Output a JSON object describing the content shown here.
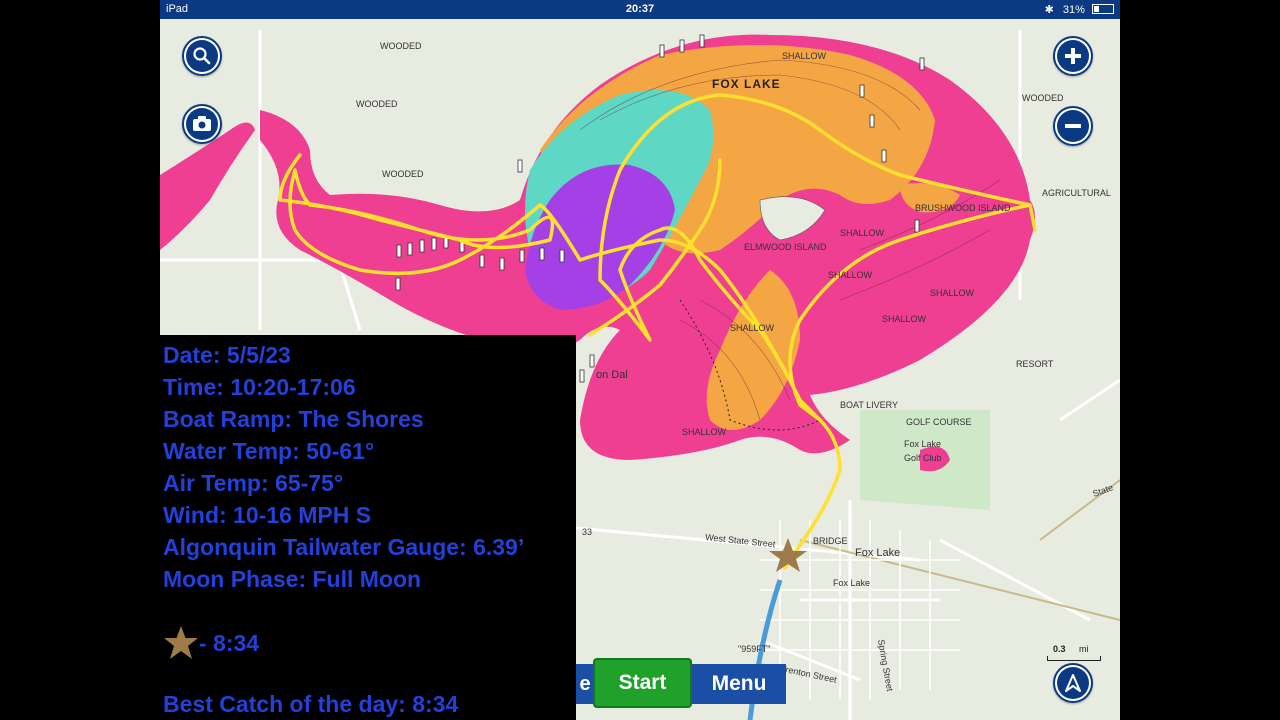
{
  "status_bar": {
    "device": "iPad",
    "time": "20:37",
    "battery": "31%"
  },
  "map": {
    "lake_name": "FOX LAKE",
    "labels": {
      "wooded_1": "WOODED",
      "wooded_2": "WOODED",
      "wooded_3": "WOODED",
      "wooded_4": "WOODED",
      "shallow_1": "SHALLOW",
      "shallow_2": "SHALLOW",
      "shallow_3": "SHALLOW",
      "shallow_4": "SHALLOW",
      "shallow_5": "SHALLOW",
      "shallow_6": "SHALLOW",
      "shallow_7": "SHALLOW",
      "brushwood_island": "BRUSHWOOD ISLAND",
      "elmwood_island": "ELMWOOD ISLAND",
      "agricultural": "AGRICULTURAL",
      "resort": "RESORT",
      "boat_livery": "BOAT LIVERY",
      "golf_course": "GOLF COURSE",
      "golf_club_1": "Fox Lake",
      "golf_club_2": "Golf Club",
      "bridge": "BRIDGE",
      "town_1": "Fox Lake",
      "town_2": "Fox Lake",
      "west_state_street": "West State Street",
      "route_33": "33",
      "spring_street": "Spring Street",
      "trenton_street": "Trenton Street",
      "state_road": "State",
      "elevation": "\"959FT\"",
      "town_partial": "on Dal"
    },
    "scale": {
      "value": "0.3",
      "unit": "mi"
    }
  },
  "controls": {
    "search_icon": "search-icon",
    "camera_icon": "camera-icon",
    "zoom_in_icon": "plus-icon",
    "zoom_out_icon": "minus-icon",
    "compass_icon": "navigation-icon"
  },
  "trip_info": {
    "date": "Date: 5/5/23",
    "time": "Time: 10:20-17:06",
    "boat_ramp": "Boat Ramp: The Shores",
    "water_temp": "Water Temp: 50-61°",
    "air_temp": "Air Temp: 65-75°",
    "wind": "Wind: 10-16 MPH S",
    "gauge": "Algonquin Tailwater Gauge: 6.39’",
    "moon": "Moon Phase: Full Moon",
    "star_time": "- 8:34",
    "best_catch": "Best Catch of the day: 8:34"
  },
  "bottom_bar": {
    "partial_label": "e",
    "start_label": "Start",
    "menu_label": "Menu"
  },
  "colors": {
    "status_bar": "#0b3a82",
    "shallow_pink": "#ee3f93",
    "mid_orange": "#f4a544",
    "deep_teal": "#5ed8c4",
    "deepest_purple": "#a540e6",
    "track_yellow": "#ffe02e",
    "info_text": "#2340d8",
    "start_button": "#1fa12b",
    "menu_button": "#1b4fa5",
    "star": "#9e7c4a"
  }
}
